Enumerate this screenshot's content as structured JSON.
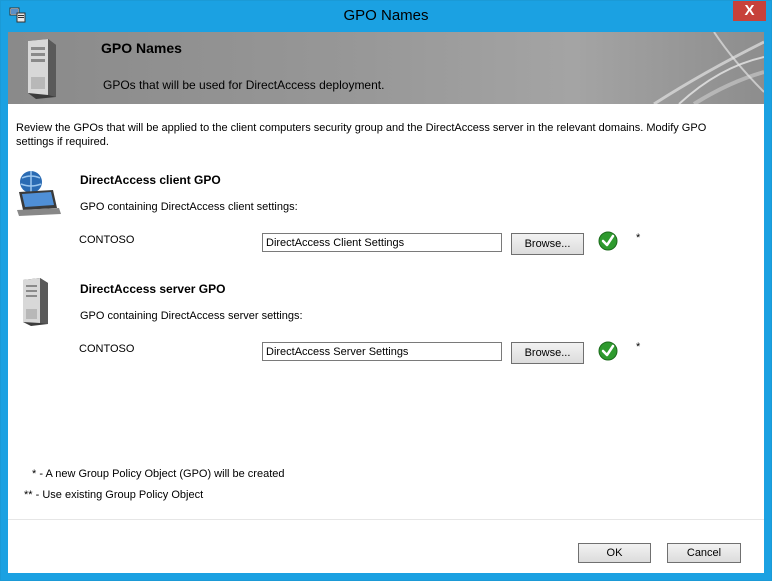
{
  "window": {
    "title": "GPO Names",
    "close_label": "X"
  },
  "header": {
    "title": "GPO Names",
    "subtitle": "GPOs that will be used for DirectAccess deployment."
  },
  "intro": "Review the GPOs that will be applied to the client computers security group and the DirectAccess server in the relevant domains. Modify GPO settings if required.",
  "client_gpo": {
    "title": "DirectAccess client GPO",
    "description": "GPO containing DirectAccess client settings:",
    "domain": "CONTOSO",
    "gpo_name": "DirectAccess Client Settings",
    "browse_label": "Browse...",
    "marker": "*",
    "status_icon": "check-icon"
  },
  "server_gpo": {
    "title": "DirectAccess server GPO",
    "description": "GPO containing DirectAccess server settings:",
    "domain": "CONTOSO",
    "gpo_name": "DirectAccess Server Settings",
    "browse_label": "Browse...",
    "marker": "*",
    "status_icon": "check-icon"
  },
  "legend": {
    "new_gpo": "* - A new Group Policy Object (GPO) will be created",
    "existing_gpo": "** - Use existing Group Policy Object"
  },
  "footer": {
    "ok_label": "OK",
    "cancel_label": "Cancel"
  },
  "colors": {
    "titlebar": "#1ba1e2",
    "close_button": "#c7413a",
    "banner": "#979797",
    "check": "#2e9a2e"
  }
}
